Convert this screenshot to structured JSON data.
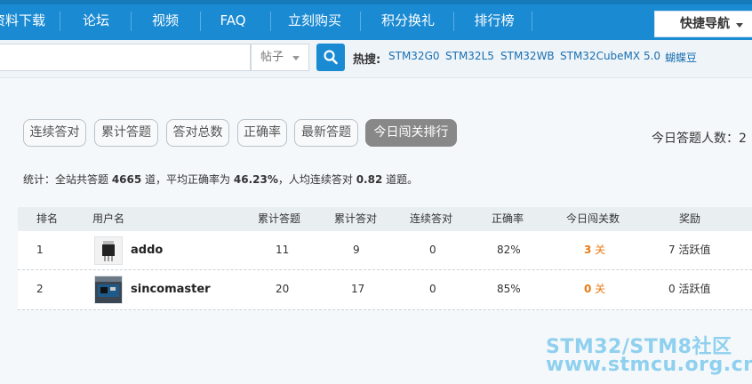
{
  "nav": {
    "items": [
      "资料下载",
      "论坛",
      "视频",
      "FAQ",
      "立刻购买",
      "积分换礼",
      "排行榜"
    ],
    "quick_nav": "快捷导航"
  },
  "search": {
    "value": "",
    "category": "帖子",
    "hot_label": "热搜:",
    "hot_links": [
      "STM32G0",
      "STM32L5",
      "STM32WB",
      "STM32CubeMX 5.0",
      "蝴蝶豆"
    ]
  },
  "tabs": [
    "连续答对",
    "累计答题",
    "答对总数",
    "正确率",
    "最新答题",
    "今日闯关排行"
  ],
  "active_tab": "今日闯关排行",
  "today_count": "今日答题人数：2",
  "stats": {
    "prefix": "统计：全站共答题 ",
    "total": "4665",
    "mid1": " 道，平均正确率为 ",
    "rate": "46.23%",
    "mid2": "，人均连续答对 ",
    "avg": "0.82",
    "suffix": " 道题。"
  },
  "table": {
    "headers": [
      "排名",
      "用户名",
      "累计答题",
      "累计答对",
      "连续答对",
      "正确率",
      "今日闯关数",
      "奖励"
    ],
    "rows": [
      {
        "rank": "1",
        "user": "addo",
        "total": "11",
        "correct": "9",
        "streak": "0",
        "rate": "82%",
        "today": "3",
        "today_unit": " 关",
        "reward": "7 活跃值"
      },
      {
        "rank": "2",
        "user": "sincomaster",
        "total": "20",
        "correct": "17",
        "streak": "0",
        "rate": "85%",
        "today": "0",
        "today_unit": " 关",
        "reward": "0 活跃值"
      }
    ]
  },
  "watermark": {
    "line1": "STM32/STM8社区",
    "line2": "www.stmcu.org.cn"
  },
  "colors": {
    "nav_bg": "#1a8ad3",
    "accent_orange": "#e87a14",
    "active_tab": "#888888"
  }
}
